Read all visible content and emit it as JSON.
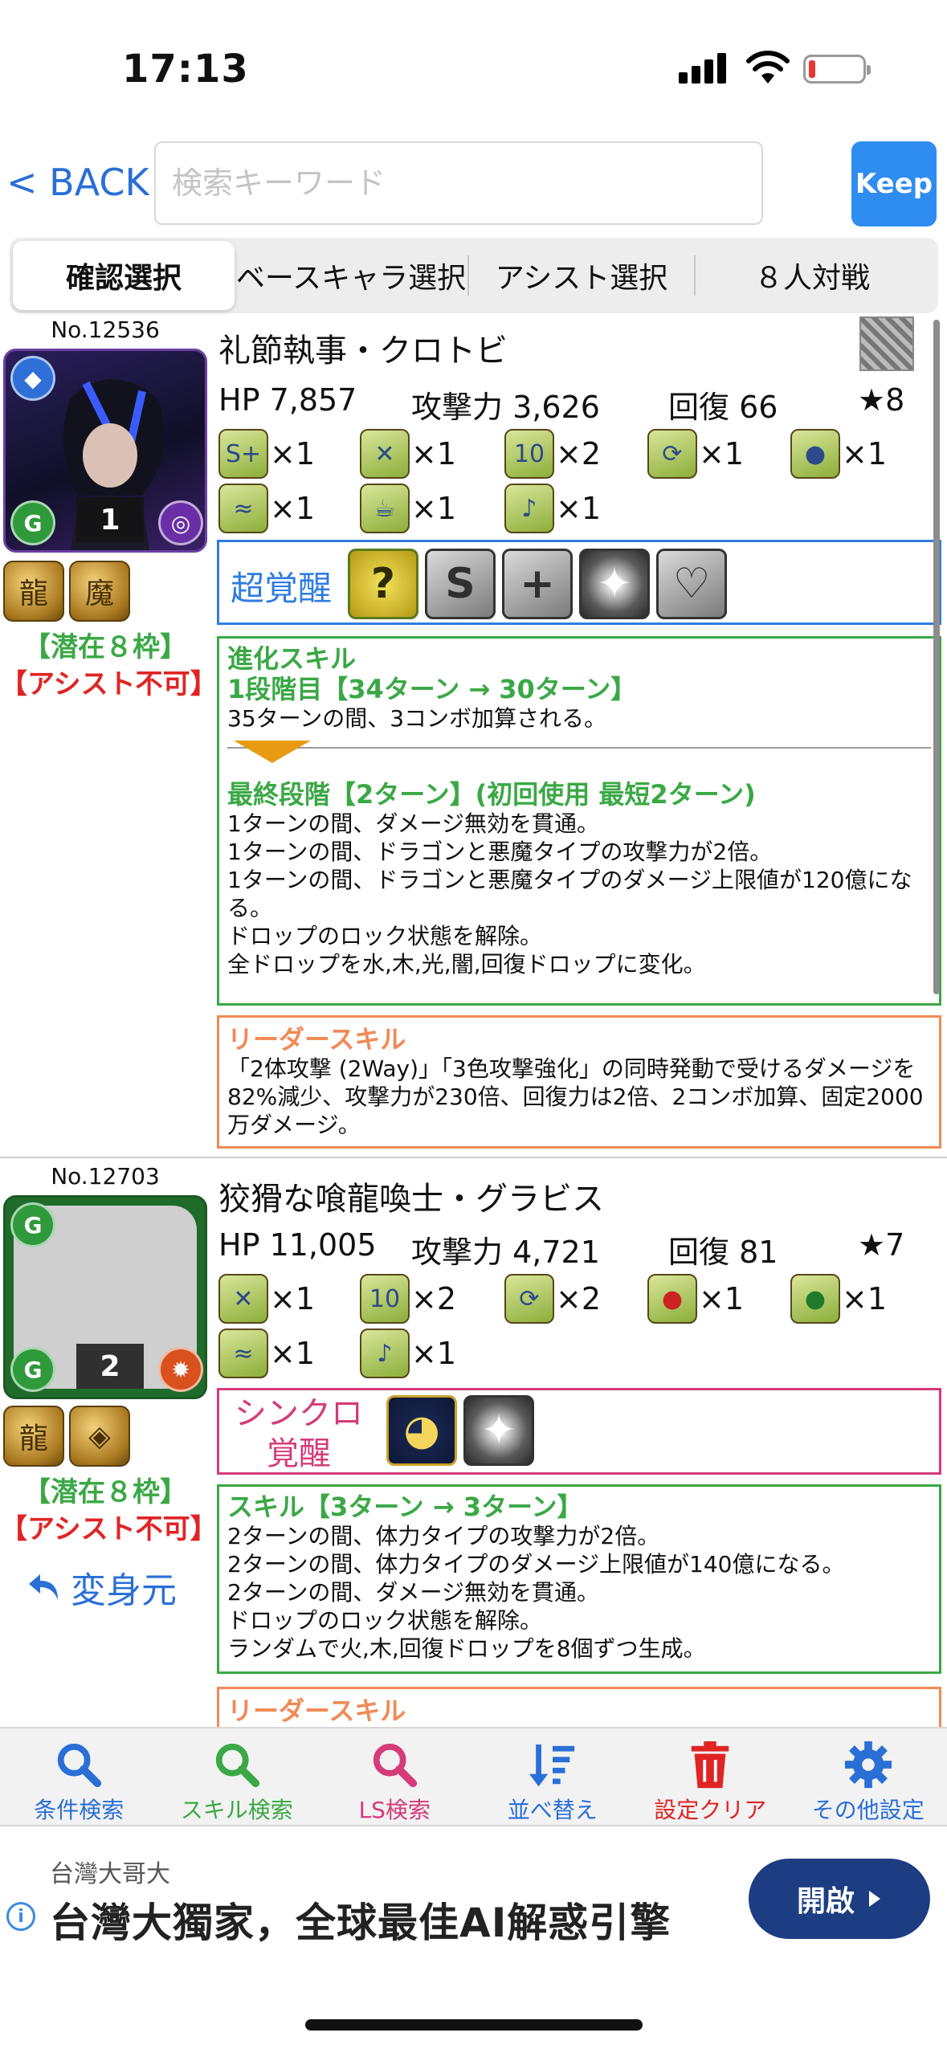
{
  "status_bar": {
    "time": "17:13"
  },
  "header": {
    "back_label": "< BACK",
    "search_placeholder": "検索キーワード",
    "keep_label": "Keep"
  },
  "tabs": [
    {
      "label": "確認選択",
      "active": true
    },
    {
      "label": "ベースキャラ選択",
      "active": false
    },
    {
      "label": "アシスト選択",
      "active": false
    },
    {
      "label": "８人対戦",
      "active": false
    }
  ],
  "monsters": [
    {
      "number": "No.12536",
      "level_badge": "1",
      "name": "礼節執事・クロトビ",
      "hp": "HP 7,857",
      "atk": "攻撃力 3,626",
      "rcv": "回復 66",
      "rarity": "★8",
      "awakenings": [
        {
          "icon": "skill-boost-icon",
          "count": "×1"
        },
        {
          "icon": "resist-bind-icon",
          "count": "×1"
        },
        {
          "icon": "enhanced-combo-icon",
          "count": "×2"
        },
        {
          "icon": "extend-time-icon",
          "count": "×1"
        },
        {
          "icon": "enhanced-orbs-icon",
          "count": "×1"
        },
        {
          "icon": "dragon-killer-icon",
          "count": "×1"
        },
        {
          "icon": "tea-icon",
          "count": "×1"
        },
        {
          "icon": "sound-icon",
          "count": "×1"
        }
      ],
      "super_awakening_label": "超覚醒",
      "super_awakenings": [
        "?",
        "S",
        "+",
        "✦",
        "♡"
      ],
      "latent_text": "【潜在８枠】",
      "assist_text": "【アシスト不可】",
      "skill": {
        "head1": "進化スキル",
        "head2": "1段階目【34ターン → 30ターン】",
        "text1": "35ターンの間、3コンボ加算される。",
        "head3": "最終段階【2ターン】(初回使用 最短2ターン)",
        "lines": [
          "1ターンの間、ダメージ無効を貫通。",
          "1ターンの間、ドラゴンと悪魔タイプの攻撃力が2倍。",
          "1ターンの間、ドラゴンと悪魔タイプのダメージ上限値が120億になる。",
          "ドロップのロック状態を解除。",
          "全ドロップを水,木,光,闇,回復ドロップに変化。"
        ]
      },
      "leader": {
        "head": "リーダースキル",
        "text": "「2体攻撃 (2Way)」「3色攻撃強化」の同時発動で受けるダメージを82%減少、攻撃力が230倍、回復力は2倍、2コンボ加算、固定2000万ダメージ。"
      }
    },
    {
      "number": "No.12703",
      "level_badge": "2",
      "name": "狡猾な喰龍喚士・グラビス",
      "hp": "HP 11,005",
      "atk": "攻撃力 4,721",
      "rcv": "回復 81",
      "rarity": "★7",
      "awakenings": [
        {
          "icon": "resist-bind-icon",
          "count": "×1"
        },
        {
          "icon": "enhanced-combo-icon",
          "count": "×2"
        },
        {
          "icon": "extend-time-icon",
          "count": "×2"
        },
        {
          "icon": "enhanced-fire-orbs-icon",
          "count": "×1"
        },
        {
          "icon": "enhanced-wood-orbs-icon",
          "count": "×1"
        },
        {
          "icon": "dragon-killer-icon",
          "count": "×1"
        },
        {
          "icon": "sound-icon",
          "count": "×1"
        }
      ],
      "sync_label_line1": "シンクロ",
      "sync_label_line2": "覚醒",
      "latent_text": "【潜在８枠】",
      "assist_text": "【アシスト不可】",
      "transform_label": "変身元",
      "skill": {
        "head": "スキル【3ターン → 3ターン】",
        "lines": [
          "2ターンの間、体力タイプの攻撃力が2倍。",
          "2ターンの間、体力タイプのダメージ上限値が140億になる。",
          "2ターンの間、ダメージ無効を貫通。",
          "ドロップのロック状態を解除。",
          "ランダムで火,木,回復ドロップを8個ずつ生成。"
        ]
      },
      "leader": {
        "head": "リーダースキル"
      }
    }
  ],
  "toolbar": [
    {
      "label": "条件検索",
      "icon": "search-icon",
      "color": "#2a6fd6"
    },
    {
      "label": "スキル検索",
      "icon": "search-icon",
      "color": "#3aa845"
    },
    {
      "label": "LS検索",
      "icon": "search-icon",
      "color": "#d43b7a"
    },
    {
      "label": "並べ替え",
      "icon": "sort-icon",
      "color": "#2a6fd6"
    },
    {
      "label": "設定クリア",
      "icon": "trash-icon",
      "color": "#e02424"
    },
    {
      "label": "その他設定",
      "icon": "gear-icon",
      "color": "#2a6fd6"
    }
  ],
  "ad": {
    "advertiser": "台灣大哥大",
    "headline": "台灣大獨家，全球最佳AI解惑引擎",
    "button": "開啟"
  }
}
